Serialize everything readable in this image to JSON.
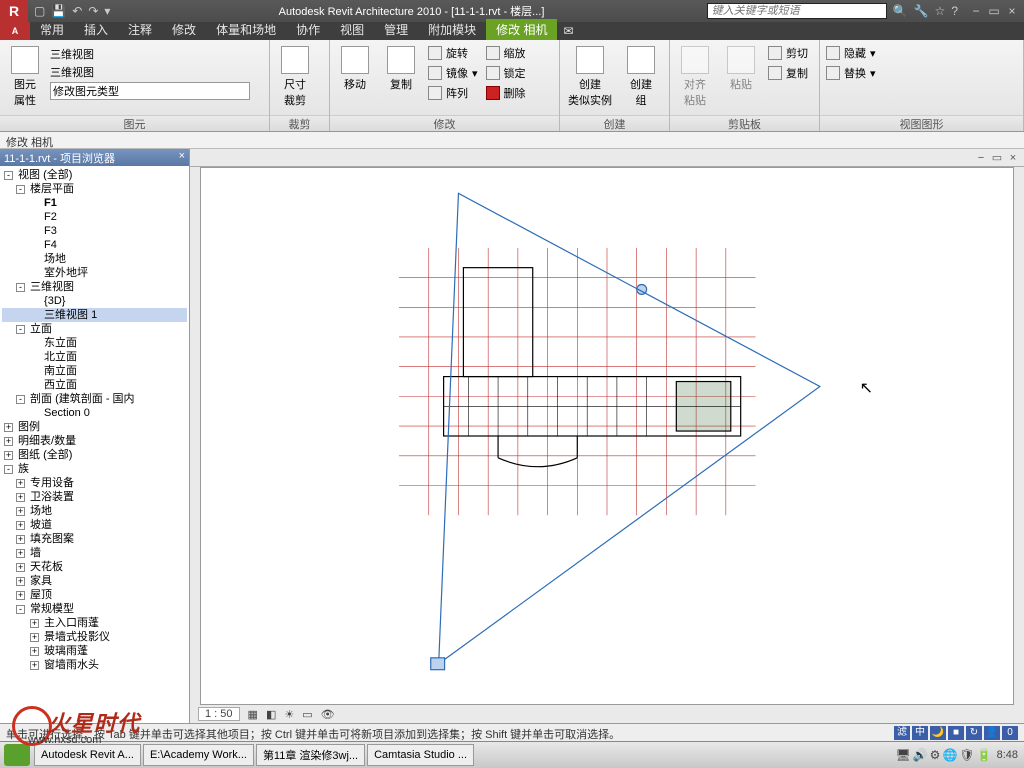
{
  "title": "Autodesk Revit Architecture 2010 - [11-1-1.rvt - 楼层...]",
  "search_placeholder": "键入关键字或短语",
  "app_menu": "A",
  "tabs": [
    "常用",
    "插入",
    "注释",
    "修改",
    "体量和场地",
    "协作",
    "视图",
    "管理",
    "附加模块"
  ],
  "active_tab": "修改 相机",
  "panels": {
    "p1": {
      "label": "图元",
      "btn": "图元\n属性",
      "type1": "三维视图",
      "type2": "三维视图",
      "type_sel": "修改图元类型"
    },
    "p2": {
      "label": "裁剪",
      "btn": "尺寸\n裁剪"
    },
    "p3": {
      "label": "修改",
      "move": "移动",
      "copy": "复制",
      "rotate": "旋转",
      "mirror": "镜像",
      "array": "阵列",
      "scale": "缩放",
      "lock": "锁定",
      "delete": "删除"
    },
    "p4": {
      "label": "创建",
      "similar": "创建\n类似实例",
      "group": "创建\n组"
    },
    "p5": {
      "label": "剪贴板",
      "align": "对齐\n粘贴",
      "paste": "粘贴",
      "cut": "剪切",
      "copy": "复制"
    },
    "p6": {
      "label": "视图图形",
      "hide": "隐藏",
      "replace": "替换"
    }
  },
  "modify_title": "修改 相机",
  "browser": {
    "title": "11-1-1.rvt - 项目浏览器",
    "nodes": [
      {
        "d": 0,
        "e": "-",
        "i": "",
        "t": "视图 (全部)"
      },
      {
        "d": 1,
        "e": "-",
        "i": "",
        "t": "楼层平面"
      },
      {
        "d": 2,
        "e": "",
        "i": "",
        "t": "F1",
        "b": true
      },
      {
        "d": 2,
        "e": "",
        "i": "",
        "t": "F2"
      },
      {
        "d": 2,
        "e": "",
        "i": "",
        "t": "F3"
      },
      {
        "d": 2,
        "e": "",
        "i": "",
        "t": "F4"
      },
      {
        "d": 2,
        "e": "",
        "i": "",
        "t": "场地"
      },
      {
        "d": 2,
        "e": "",
        "i": "",
        "t": "室外地坪"
      },
      {
        "d": 1,
        "e": "-",
        "i": "",
        "t": "三维视图"
      },
      {
        "d": 2,
        "e": "",
        "i": "",
        "t": "{3D}"
      },
      {
        "d": 2,
        "e": "",
        "i": "",
        "t": "三维视图 1",
        "sel": true
      },
      {
        "d": 1,
        "e": "-",
        "i": "",
        "t": "立面"
      },
      {
        "d": 2,
        "e": "",
        "i": "",
        "t": "东立面"
      },
      {
        "d": 2,
        "e": "",
        "i": "",
        "t": "北立面"
      },
      {
        "d": 2,
        "e": "",
        "i": "",
        "t": "南立面"
      },
      {
        "d": 2,
        "e": "",
        "i": "",
        "t": "西立面"
      },
      {
        "d": 1,
        "e": "-",
        "i": "",
        "t": "剖面 (建筑剖面 - 国内"
      },
      {
        "d": 2,
        "e": "",
        "i": "",
        "t": "Section 0"
      },
      {
        "d": 0,
        "e": "+",
        "i": "",
        "t": "图例"
      },
      {
        "d": 0,
        "e": "+",
        "i": "",
        "t": "明细表/数量"
      },
      {
        "d": 0,
        "e": "+",
        "i": "",
        "t": "图纸 (全部)"
      },
      {
        "d": 0,
        "e": "-",
        "i": "",
        "t": "族"
      },
      {
        "d": 1,
        "e": "+",
        "i": "",
        "t": "专用设备"
      },
      {
        "d": 1,
        "e": "+",
        "i": "",
        "t": "卫浴装置"
      },
      {
        "d": 1,
        "e": "+",
        "i": "",
        "t": "场地"
      },
      {
        "d": 1,
        "e": "+",
        "i": "",
        "t": "坡道"
      },
      {
        "d": 1,
        "e": "+",
        "i": "",
        "t": "填充图案"
      },
      {
        "d": 1,
        "e": "+",
        "i": "",
        "t": "墙"
      },
      {
        "d": 1,
        "e": "+",
        "i": "",
        "t": "天花板"
      },
      {
        "d": 1,
        "e": "+",
        "i": "",
        "t": "家具"
      },
      {
        "d": 1,
        "e": "+",
        "i": "",
        "t": "屋顶"
      },
      {
        "d": 1,
        "e": "-",
        "i": "",
        "t": "常规模型"
      },
      {
        "d": 2,
        "e": "+",
        "i": "",
        "t": "主入口雨蓬"
      },
      {
        "d": 2,
        "e": "+",
        "i": "",
        "t": "景墙式投影仪"
      },
      {
        "d": 2,
        "e": "+",
        "i": "",
        "t": "玻璃雨蓬"
      },
      {
        "d": 2,
        "e": "+",
        "i": "",
        "t": "窗墙雨水头"
      }
    ]
  },
  "scale": "1 : 50",
  "status_text": "单击可进行选择；按 Tab 键并单击可选择其他项目；按 Ctrl 键并单击可将新项目添加到选择集；按 Shift 键并单击可取消选择。",
  "status_icons": [
    "滤",
    "中",
    "🌙",
    "■",
    "↻",
    "👤",
    "0"
  ],
  "taskbar": {
    "items": [
      "Autodesk Revit A...",
      "E:\\Academy Work...",
      "第11章 渲染修3wj...",
      "Camtasia Studio ..."
    ],
    "clock": "8:48"
  },
  "watermark": {
    "brand": "火星时代",
    "url": "www.hxsd.com"
  }
}
